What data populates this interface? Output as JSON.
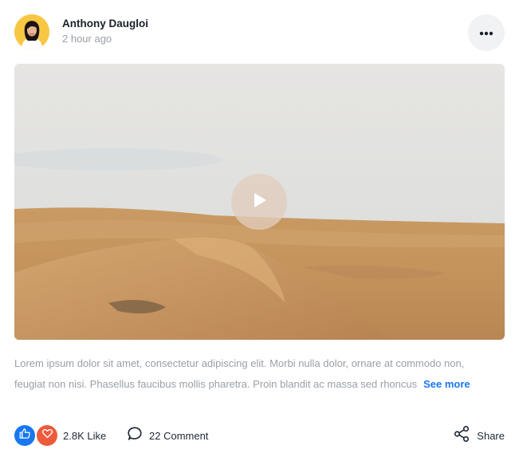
{
  "post": {
    "author": "Anthony Daugloi",
    "time": "2 hour ago",
    "avatar_bg": "#f7c744",
    "text": "Lorem ipsum dolor sit amet, consectetur adipiscing elit. Morbi nulla dolor, ornare at commodo non, feugiat non nisi. Phasellus faucibus mollis pharetra. Proin blandit ac massa sed rhoncus",
    "see_more": "See more",
    "more_icon": "more-horizontal-icon",
    "media_icon": "play-icon"
  },
  "actions": {
    "like_count": "2.8K Like",
    "comment_count": "22 Comment",
    "share_label": "Share",
    "like_color": "#1877f2",
    "love_color": "#ee5a3c",
    "link_color": "#1877f2"
  }
}
